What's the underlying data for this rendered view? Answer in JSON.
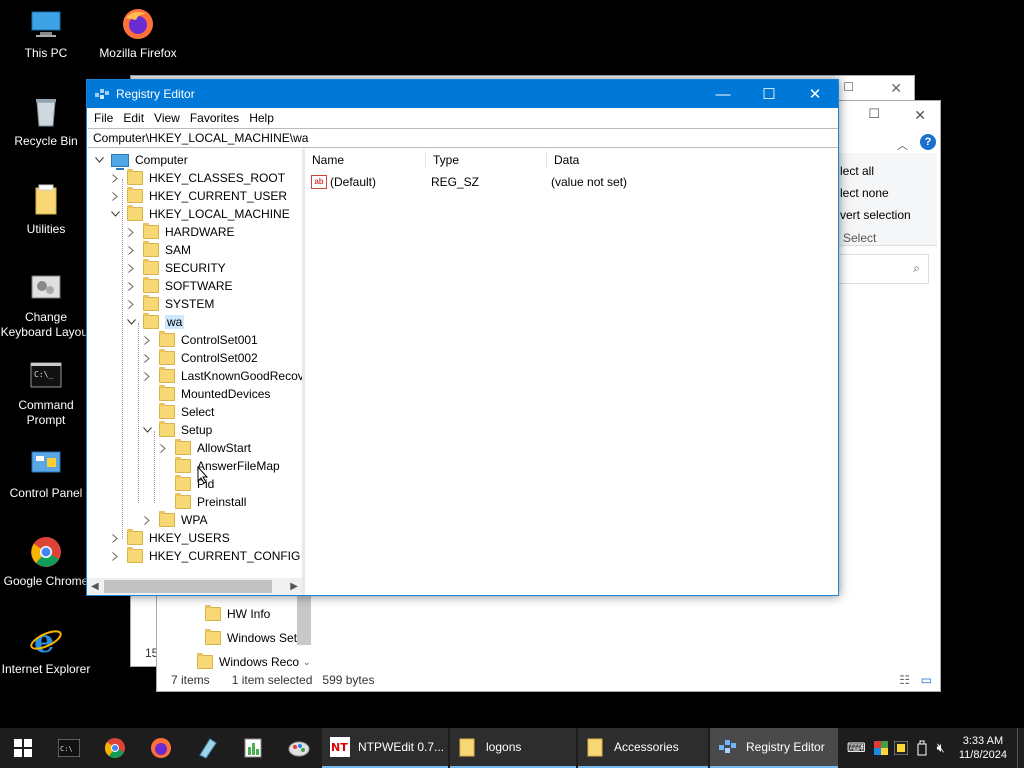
{
  "desktop": {
    "icons": [
      {
        "label": "This PC"
      },
      {
        "label": "Mozilla Firefox"
      },
      {
        "label": "Recycle Bin"
      },
      {
        "label": "Utilities"
      },
      {
        "label": "Change Keyboard Layout"
      },
      {
        "label": "Command Prompt"
      },
      {
        "label": "Control Panel"
      },
      {
        "label": "Google Chrome"
      },
      {
        "label": "Internet Explorer"
      }
    ]
  },
  "explorer_front": {
    "ribbon_items": [
      "lect all",
      "lect none",
      "vert selection",
      "Select"
    ],
    "nav_items": [
      "HW Info",
      "Windows Setu",
      "Windows Reco"
    ],
    "status_items": "7 items",
    "status_selected": "1 item selected",
    "status_size": "599 bytes",
    "partial_text": "15"
  },
  "regedit": {
    "title": "Registry Editor",
    "menu": [
      "File",
      "Edit",
      "View",
      "Favorites",
      "Help"
    ],
    "address": "Computer\\HKEY_LOCAL_MACHINE\\wa",
    "tree": [
      {
        "label": "Computer",
        "expand": "v"
      },
      {
        "label": "HKEY_CLASSES_ROOT",
        "expand": ">"
      },
      {
        "label": "HKEY_CURRENT_USER",
        "expand": ">"
      },
      {
        "label": "HKEY_LOCAL_MACHINE",
        "expand": "v"
      },
      {
        "label": "HARDWARE",
        "expand": ">"
      },
      {
        "label": "SAM",
        "expand": ">"
      },
      {
        "label": "SECURITY",
        "expand": ">"
      },
      {
        "label": "SOFTWARE",
        "expand": ">"
      },
      {
        "label": "SYSTEM",
        "expand": ">"
      },
      {
        "label": "wa",
        "expand": "v"
      },
      {
        "label": "ControlSet001",
        "expand": ">"
      },
      {
        "label": "ControlSet002",
        "expand": ">"
      },
      {
        "label": "LastKnownGoodRecove",
        "expand": ">"
      },
      {
        "label": "MountedDevices",
        "expand": ""
      },
      {
        "label": "Select",
        "expand": ""
      },
      {
        "label": "Setup",
        "expand": "v"
      },
      {
        "label": "AllowStart",
        "expand": ">"
      },
      {
        "label": "AnswerFileMap",
        "expand": ""
      },
      {
        "label": "Pid",
        "expand": ""
      },
      {
        "label": "Preinstall",
        "expand": ""
      },
      {
        "label": "WPA",
        "expand": ">"
      },
      {
        "label": "HKEY_USERS",
        "expand": ">"
      },
      {
        "label": "HKEY_CURRENT_CONFIG",
        "expand": ">"
      }
    ],
    "columns": [
      "Name",
      "Type",
      "Data"
    ],
    "values": [
      {
        "name": "(Default)",
        "type": "REG_SZ",
        "data": "(value not set)"
      }
    ]
  },
  "taskbar": {
    "buttons": [
      {
        "label": "NTPWEdit 0.7..."
      },
      {
        "label": "logons"
      },
      {
        "label": "Accessories"
      },
      {
        "label": "Registry Editor"
      }
    ],
    "time": "3:33 AM",
    "date": "11/8/2024"
  }
}
